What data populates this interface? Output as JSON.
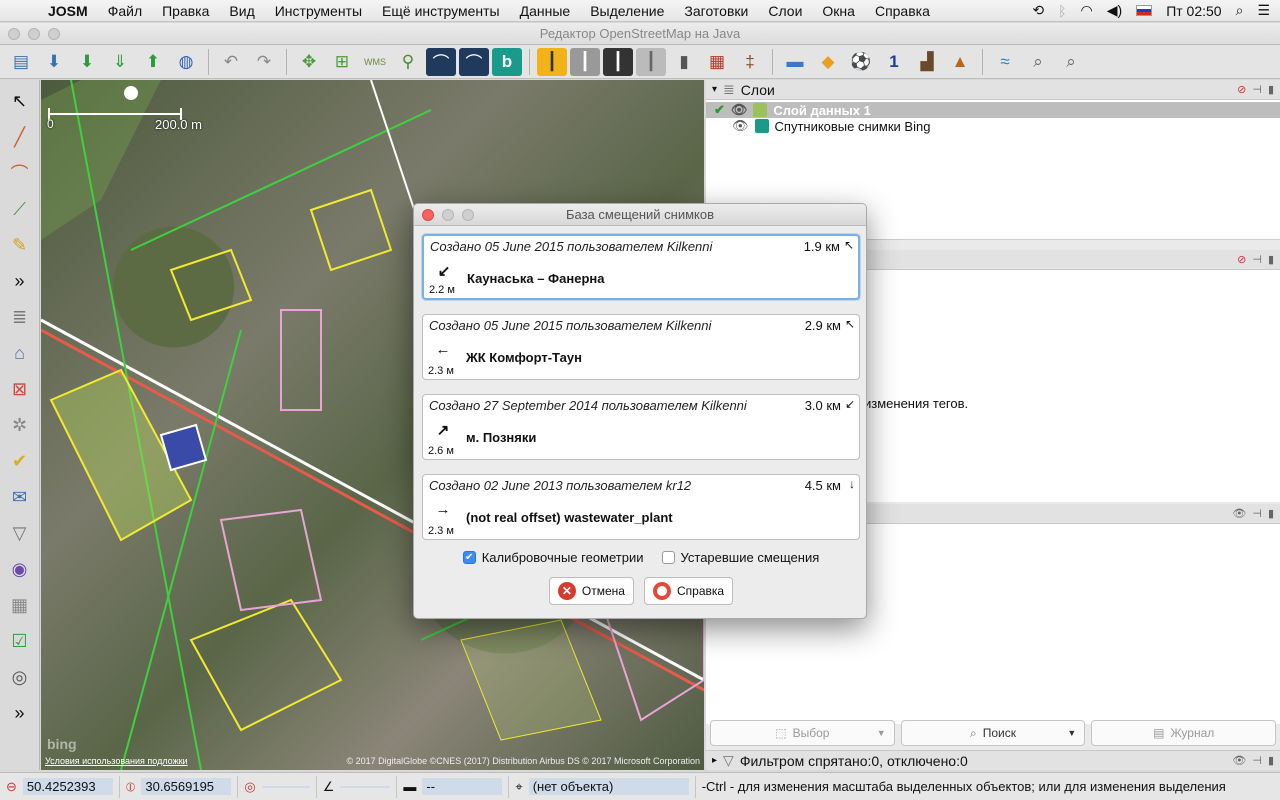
{
  "menubar": {
    "app": "JOSM",
    "items": [
      "Файл",
      "Правка",
      "Вид",
      "Инструменты",
      "Ещё инструменты",
      "Данные",
      "Выделение",
      "Заготовки",
      "Слои",
      "Окна",
      "Справка"
    ],
    "clock": "Пт 02:50"
  },
  "window": {
    "title": "Редактор OpenStreetMap на Java"
  },
  "map": {
    "scale_zero": "0",
    "scale_label": "200.0 m",
    "attrib_left": "Условия использования подложки",
    "attrib_right": "© 2017 DigitalGlobe ©CNES (2017) Distribution Airbus DS © 2017 Microsoft Corporation",
    "bing_logo": "bing"
  },
  "layers": {
    "title": "Слои",
    "items": [
      {
        "name": "Слой данных 1",
        "selected": true
      },
      {
        "name": "Спутниковые снимки Bing",
        "selected": false
      }
    ]
  },
  "panel2": {
    "hint": "изменения тегов."
  },
  "panel_buttons": {
    "select": "Выбор",
    "search": "Поиск",
    "log": "Журнал"
  },
  "filter_bar": {
    "text": "Фильтром спрятано:0, отключено:0"
  },
  "statusbar": {
    "lat": "50.4252393",
    "lon": "30.6569195",
    "heading": "",
    "angle": "",
    "distance": "--",
    "object": "(нет объекта)",
    "help": "-Ctrl - для изменения масштаба выделенных объектов; или для изменения выделения"
  },
  "dialog": {
    "title": "База смещений снимков",
    "offsets": [
      {
        "created": "Создано 05 June 2015 пользователем Kilkenni",
        "distance": "1.9 км",
        "dir": "↖",
        "icon": "↙",
        "name": "Каунаська – Фанерна",
        "shift": "2.2 м"
      },
      {
        "created": "Создано 05 June 2015 пользователем Kilkenni",
        "distance": "2.9 км",
        "dir": "↖",
        "icon": "←",
        "name": "ЖК Комфорт-Таун",
        "shift": "2.3 м"
      },
      {
        "created": "Создано 27 September 2014 пользователем Kilkenni",
        "distance": "3.0 км",
        "dir": "↙",
        "icon": "↗",
        "name": "м. Позняки",
        "shift": "2.6 м"
      },
      {
        "created": "Создано 02 June 2013 пользователем kr12",
        "distance": "4.5 км",
        "dir": "↓",
        "icon": "→",
        "name": "(not real offset) wastewater_plant",
        "shift": "2.3 м"
      }
    ],
    "calibration_label": "Калибровочные геометрии",
    "calibration_checked": true,
    "deprecated_label": "Устаревшие смещения",
    "deprecated_checked": false,
    "cancel_label": "Отмена",
    "help_label": "Справка"
  }
}
